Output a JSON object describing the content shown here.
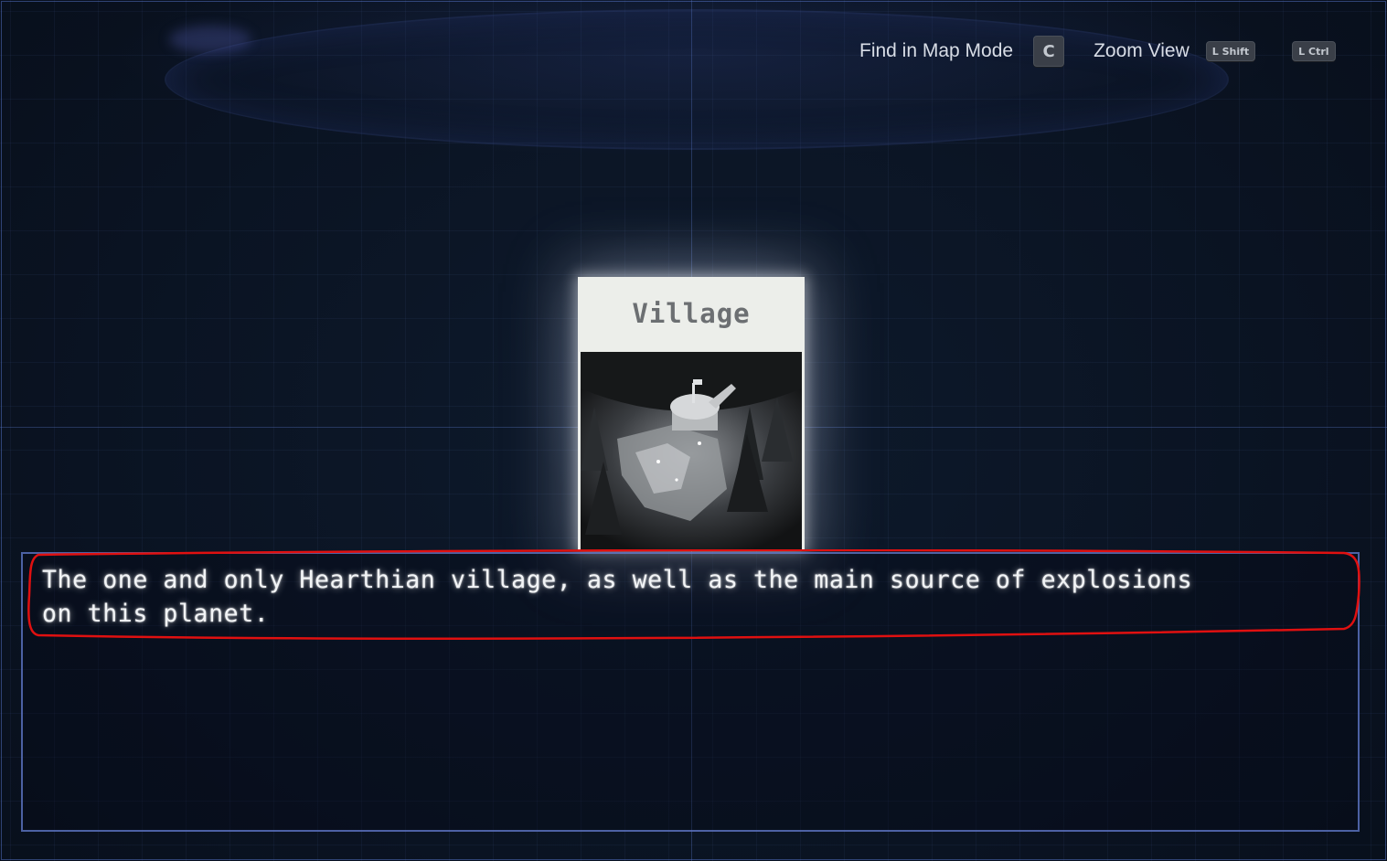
{
  "hints": {
    "find_label": "Find in Map Mode",
    "find_key": "C",
    "zoom_label": "Zoom View",
    "shift_key": "L Shift",
    "ctrl_key": "L Ctrl"
  },
  "card": {
    "title": "Village",
    "image": "village-photo"
  },
  "description": "The one and only Hearthian village, as well as the main source of explosions\non this planet.",
  "colors": {
    "background": "#0b1220",
    "grid_line": "#465f96",
    "box_border": "#647dd2",
    "card_bg": "#eceeea",
    "annotation": "#e01010"
  }
}
